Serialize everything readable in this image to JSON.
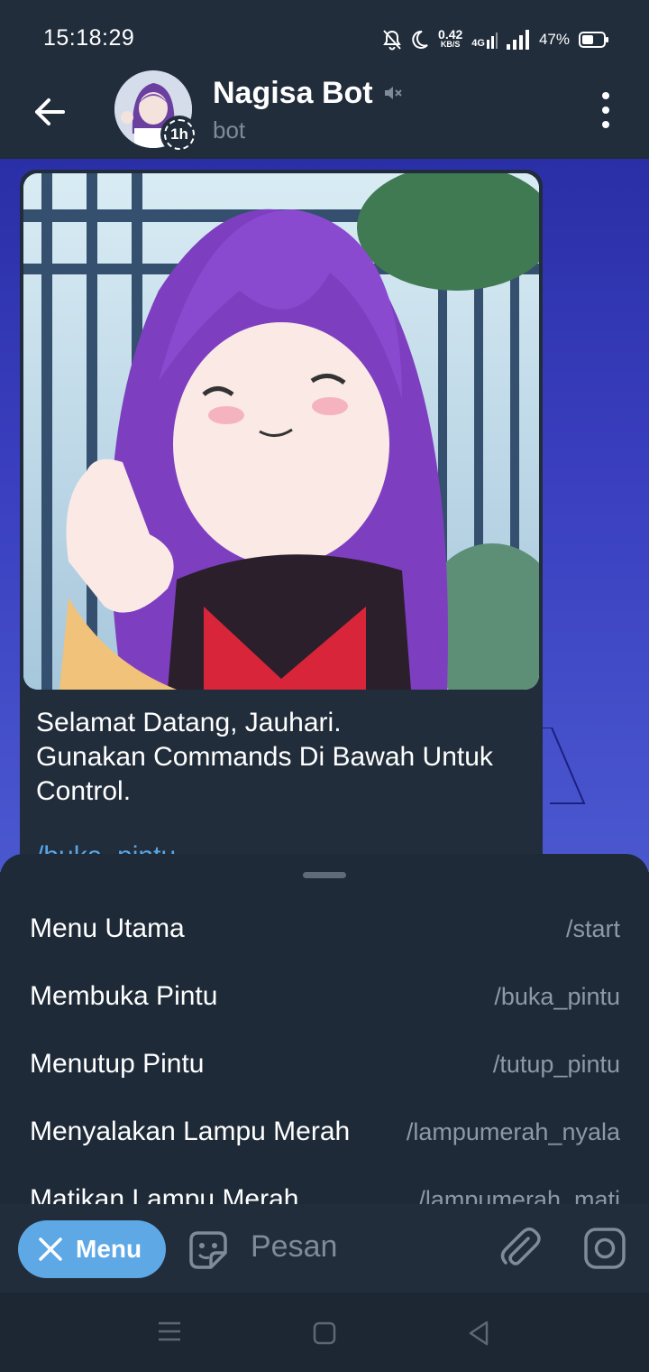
{
  "status_bar": {
    "time": "15:18:29",
    "net_speed_value": "0.42",
    "net_speed_unit": "KB/S",
    "network_type": "4G",
    "battery_percent": "47%",
    "icons": [
      "notifications-off-icon",
      "do-not-disturb-moon-icon",
      "data-arrows-icon",
      "signal-icon",
      "battery-icon"
    ]
  },
  "header": {
    "title": "Nagisa Bot",
    "subtitle": "bot",
    "story_badge": "1h",
    "icons": [
      "back-arrow-icon",
      "muted-speaker-icon",
      "more-vertical-icon"
    ]
  },
  "message": {
    "image_description_icon": "anime-avatar-photo",
    "caption_lines": [
      "Selamat Datang, Jauhari.",
      "Gunakan Commands Di Bawah Untuk",
      "Control."
    ],
    "partial_command": "/buka_pintu"
  },
  "command_sheet": {
    "commands": [
      {
        "name": "Menu Utama",
        "command": "/start"
      },
      {
        "name": "Membuka Pintu",
        "command": "/buka_pintu"
      },
      {
        "name": "Menutup Pintu",
        "command": "/tutup_pintu"
      },
      {
        "name": "Menyalakan Lampu Merah",
        "command": "/lampumerah_nyala"
      },
      {
        "name": "Matikan Lampu Merah",
        "command": "/lampumerah_mati"
      }
    ]
  },
  "input_bar": {
    "menu_label": "Menu",
    "placeholder": "Pesan",
    "icons": [
      "close-x-icon",
      "sticker-smile-icon",
      "paperclip-icon",
      "instagram-camera-icon"
    ]
  },
  "colors": {
    "app_bg": "#212d3b",
    "sheet_bg": "#1e2a38",
    "accent": "#5ea8e6",
    "link": "#5aa7e8",
    "chat_bg": "#3a3fc0"
  }
}
